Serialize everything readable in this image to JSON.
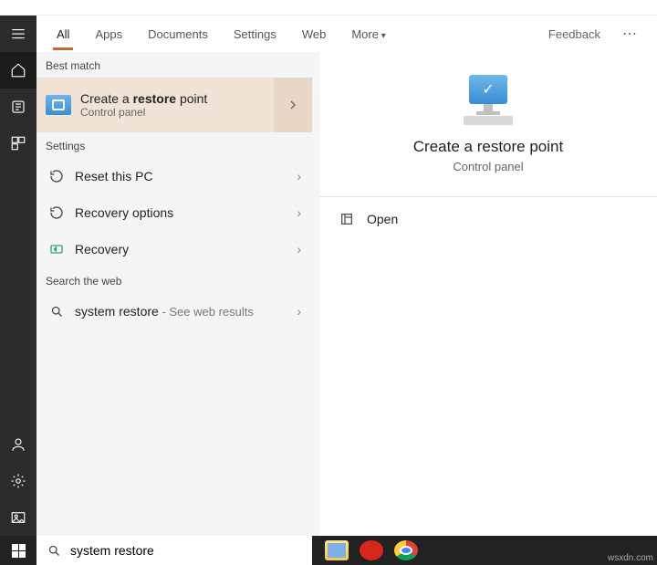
{
  "tabs": {
    "all": "All",
    "apps": "Apps",
    "documents": "Documents",
    "settings": "Settings",
    "web": "Web",
    "more": "More",
    "feedback": "Feedback"
  },
  "sections": {
    "bestmatch": "Best match",
    "settings": "Settings",
    "searchweb": "Search the web"
  },
  "bestmatch": {
    "line1a": "Create a ",
    "line1b": "restore",
    "line1c": " point",
    "line2": "Control panel"
  },
  "rows": {
    "reset": "Reset this PC",
    "recopts": "Recovery options",
    "recovery": "Recovery",
    "webprefix": "system restore",
    "websuffix": " - See web results"
  },
  "preview": {
    "title": "Create a restore point",
    "subtitle": "Control panel",
    "open": "Open"
  },
  "search": {
    "value": "system restore"
  },
  "watermark": "wsxdn.com"
}
